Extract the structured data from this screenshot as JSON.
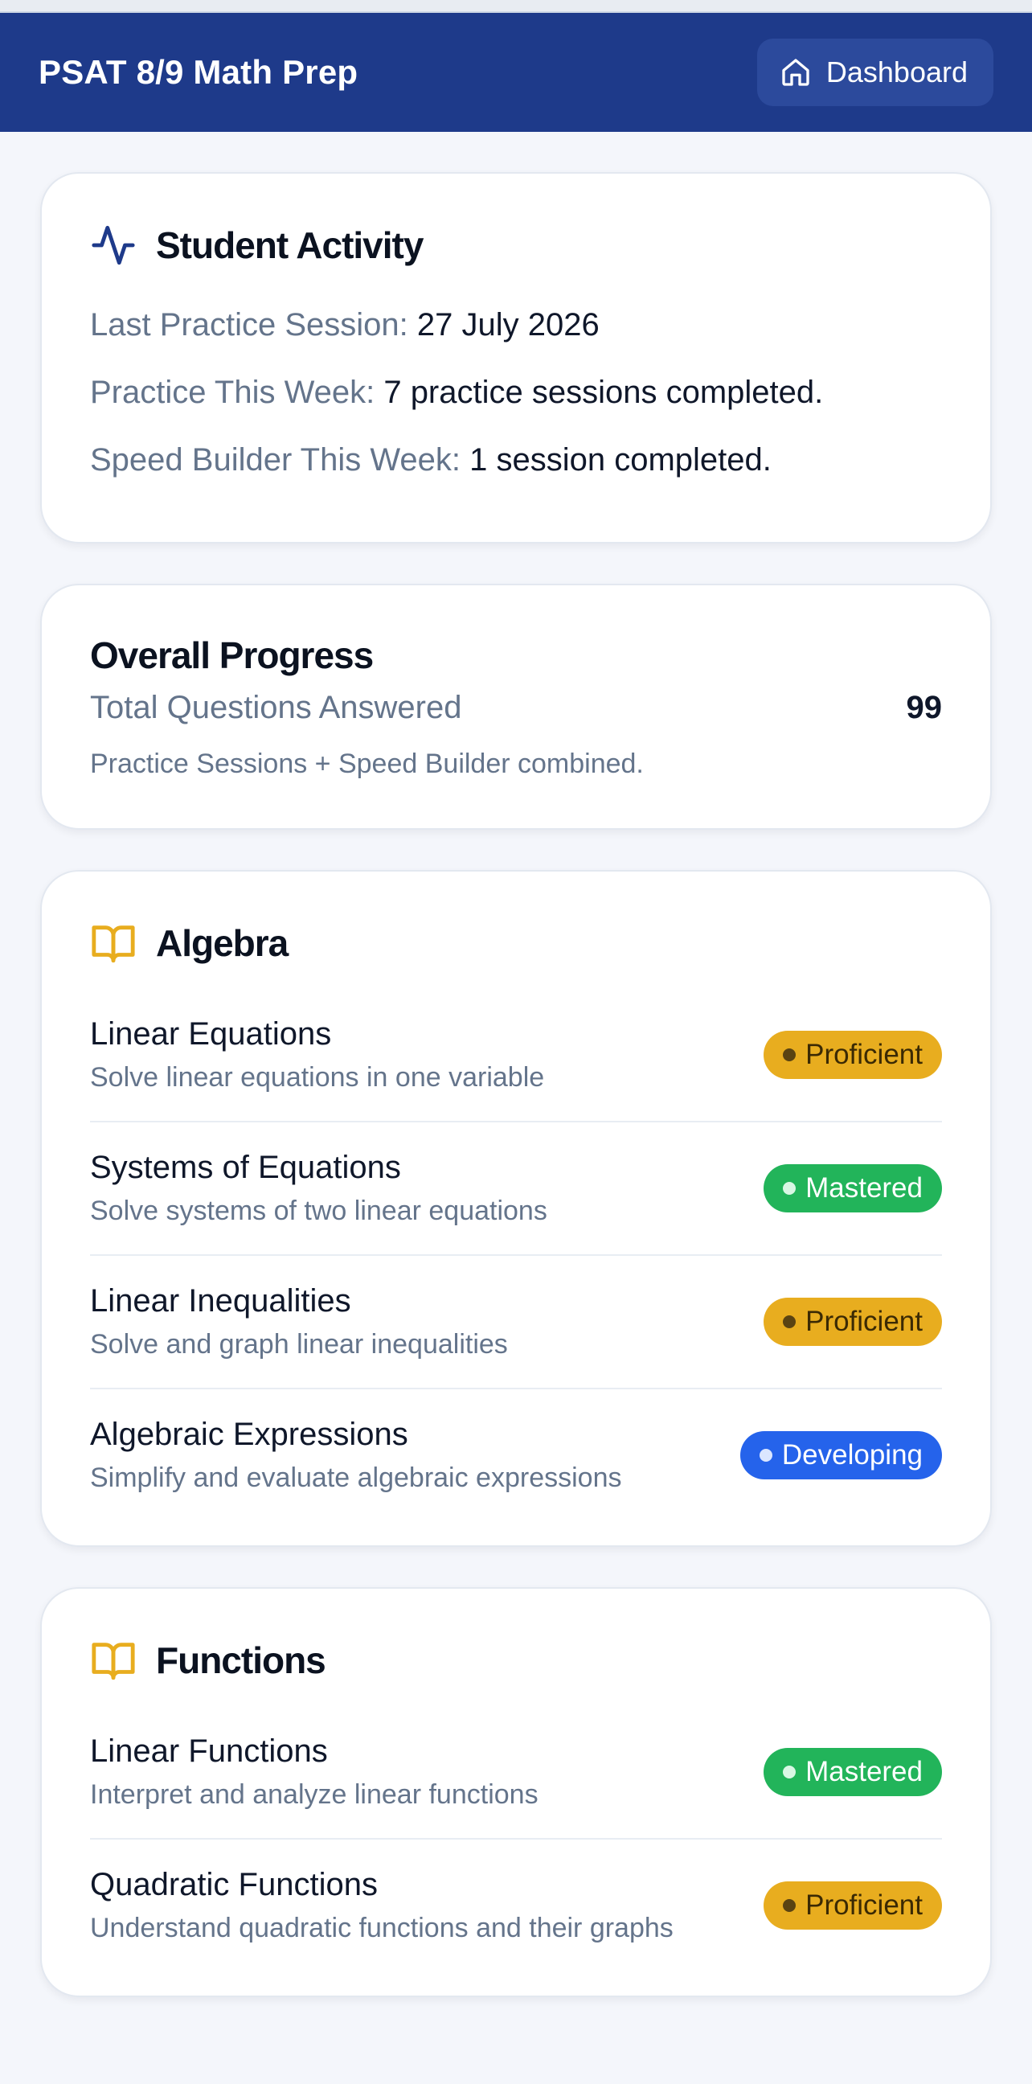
{
  "header": {
    "title": "PSAT 8/9 Math Prep",
    "dashboard_label": "Dashboard"
  },
  "activity": {
    "title": "Student Activity",
    "icon": "activity-pulse-icon",
    "last_session_label": "Last Practice Session:",
    "last_session_value": "27 July 2026",
    "week_label": "Practice This Week:",
    "week_value": "7 practice sessions completed.",
    "speed_label": "Speed Builder This Week:",
    "speed_value": "1 session completed."
  },
  "progress": {
    "title": "Overall Progress",
    "total_label": "Total Questions Answered",
    "total_value": "99",
    "note": "Practice Sessions + Speed Builder combined."
  },
  "colors": {
    "header_bg": "#1e3a8a",
    "proficient": "#e8ad1f",
    "mastered": "#22b45a",
    "developing": "#2563eb",
    "book_icon": "#e8ad1f"
  },
  "sections": [
    {
      "title": "Algebra",
      "icon": "book-open-icon",
      "skills": [
        {
          "name": "Linear Equations",
          "desc": "Solve linear equations in one variable",
          "status": "Proficient"
        },
        {
          "name": "Systems of Equations",
          "desc": "Solve systems of two linear equations",
          "status": "Mastered"
        },
        {
          "name": "Linear Inequalities",
          "desc": "Solve and graph linear inequalities",
          "status": "Proficient"
        },
        {
          "name": "Algebraic Expressions",
          "desc": "Simplify and evaluate algebraic expressions",
          "status": "Developing"
        }
      ]
    },
    {
      "title": "Functions",
      "icon": "book-open-icon",
      "skills": [
        {
          "name": "Linear Functions",
          "desc": "Interpret and analyze linear functions",
          "status": "Mastered"
        },
        {
          "name": "Quadratic Functions",
          "desc": "Understand quadratic functions and their graphs",
          "status": "Proficient"
        }
      ]
    }
  ]
}
